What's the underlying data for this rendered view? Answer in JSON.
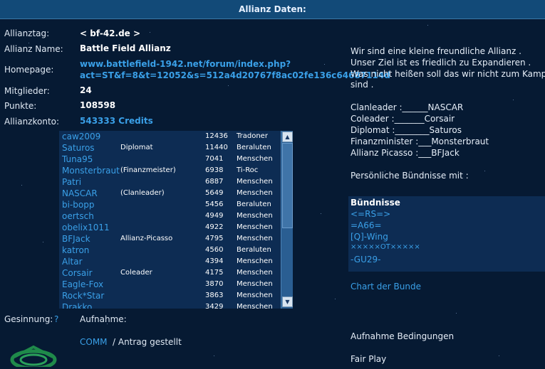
{
  "header": {
    "title": "Allianz Daten:"
  },
  "info": {
    "tag_label": "Allianztag:",
    "tag_value": "< bf-42.de >",
    "name_label": "Allianz Name:",
    "name_value": "Battle Field Allianz",
    "homepage_label": "Homepage:",
    "homepage_line1": "www.battlefield-1942.net/forum/index.php?",
    "homepage_line2": "act=ST&f=8&t=12052&s=512a4d20767f8ac02fe136c64687114d",
    "members_label": "Mitglieder:",
    "members_value": "24",
    "points_label": "Punkte:",
    "points_value": "108598",
    "account_label": "Allianzkonto:",
    "account_value": "543333 Credits"
  },
  "members": [
    {
      "name": "caw2009",
      "role": "",
      "points": "12436",
      "race": "Tradoner"
    },
    {
      "name": "Saturos",
      "role": "Diplomat",
      "points": "11440",
      "race": "Beraluten"
    },
    {
      "name": "Tuna95",
      "role": "",
      "points": "7041",
      "race": "Menschen"
    },
    {
      "name": "Monsterbraut",
      "role": "(Finanzmeister)",
      "points": "6938",
      "race": "Ti-Roc"
    },
    {
      "name": "Patri",
      "role": "",
      "points": "6887",
      "race": "Menschen"
    },
    {
      "name": "NASCAR",
      "role": "(Clanleader)",
      "points": "5649",
      "race": "Menschen"
    },
    {
      "name": "bi-bopp",
      "role": "",
      "points": "5456",
      "race": "Beraluten"
    },
    {
      "name": "oertsch",
      "role": "",
      "points": "4949",
      "race": "Menschen"
    },
    {
      "name": "obelix1011",
      "role": "",
      "points": "4922",
      "race": "Menschen"
    },
    {
      "name": "BFJack",
      "role": "Allianz-Picasso",
      "points": "4795",
      "race": "Menschen"
    },
    {
      "name": "katron",
      "role": "",
      "points": "4560",
      "race": "Beraluten"
    },
    {
      "name": "Altar",
      "role": "",
      "points": "4394",
      "race": "Menschen"
    },
    {
      "name": "Corsair",
      "role": "Coleader",
      "points": "4175",
      "race": "Menschen"
    },
    {
      "name": "Eagle-Fox",
      "role": "",
      "points": "3870",
      "race": "Menschen"
    },
    {
      "name": "Rock*Star",
      "role": "",
      "points": "3863",
      "race": "Menschen"
    },
    {
      "name": "Drakko",
      "role": "",
      "points": "3429",
      "race": "Menschen"
    }
  ],
  "scroll": {
    "up_icon": "▲",
    "down_icon": "▼"
  },
  "description": {
    "line1": "Wir sind eine kleine freundliche Allianz .",
    "line2": "Unser Ziel ist es friedlich zu Expandieren .",
    "line3": "Was nicht heißen soll das wir nicht zum Kamp",
    "line4": "sind .",
    "roles1": "Clanleader :______NASCAR",
    "roles2": "Coleader :_______Corsair",
    "roles3": "Diplomat :________Saturos",
    "roles4": "Finanzminister :___Monsterbraut",
    "roles5": "Allianz Picasso :___BFJack",
    "personal": "Persönliche Bündnisse mit :"
  },
  "alliances": {
    "title": "Bündnisse",
    "items": [
      "<=RS=>",
      "=A66=",
      "[Q]-Wing",
      "×××××OT×××××",
      "-GU29-"
    ]
  },
  "chart_link": "Chart der Bunde",
  "bottom": {
    "gesinnung_label": "Gesinnung:",
    "gesinnung_help": "?",
    "aufnahme_label": "Aufnahme:",
    "comm_link": "COMM",
    "antrag_text": "/  Antrag gestellt",
    "conditions_label": "Aufnahme Bedingungen",
    "fair_play": "Fair Play"
  }
}
